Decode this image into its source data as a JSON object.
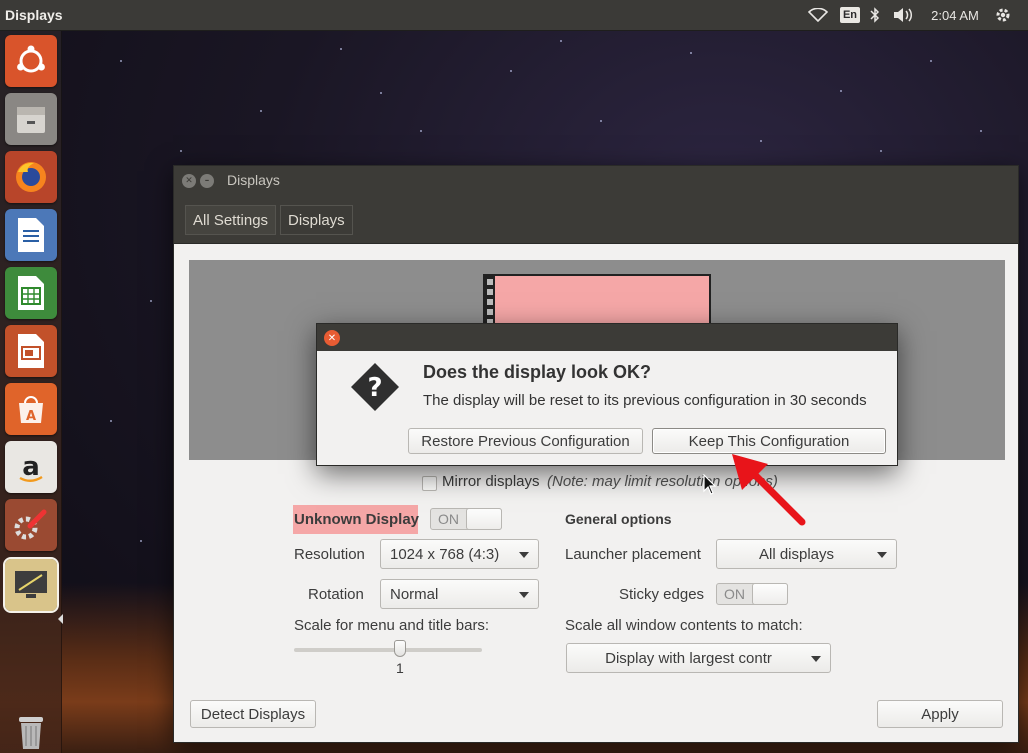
{
  "top_panel": {
    "app_title": "Displays",
    "keyboard_layout": "En",
    "clock": "2:04 AM",
    "icons": [
      "wifi-icon",
      "bluetooth-icon",
      "volume-icon",
      "gear-icon"
    ]
  },
  "launcher": {
    "items": [
      "ubuntu-dash-icon",
      "files-icon",
      "firefox-icon",
      "writer-icon",
      "calc-icon",
      "impress-icon",
      "software-center-icon",
      "amazon-icon",
      "system-settings-icon",
      "displays-icon",
      "trash-icon"
    ]
  },
  "window": {
    "title": "Displays",
    "breadcrumbs": [
      "All Settings",
      "Displays"
    ],
    "mirror_label": "Mirror displays",
    "mirror_note": "(Note: may limit resolution options)",
    "display_name": "Unknown Display",
    "display_switch": "ON",
    "resolution_label": "Resolution",
    "resolution_value": "1024 x 768 (4:3)",
    "rotation_label": "Rotation",
    "rotation_value": "Normal",
    "scale_label": "Scale for menu and title bars:",
    "scale_value": "1",
    "general_heading": "General options",
    "launcher_label": "Launcher placement",
    "launcher_value": "All displays",
    "sticky_label": "Sticky edges",
    "sticky_switch": "ON",
    "scale_all_label": "Scale all window contents to match:",
    "scale_all_value": "Display with largest contr",
    "detect_button": "Detect Displays",
    "apply_button": "Apply"
  },
  "dialog": {
    "heading": "Does the display look OK?",
    "message": "The display will be reset to its previous configuration in 30 seconds",
    "restore_button": "Restore Previous Configuration",
    "keep_button": "Keep This Configuration"
  },
  "colors": {
    "panel": "#3b3a37",
    "accent_close": "#e85c33",
    "display_highlight": "#f5a7a7",
    "annotation_arrow": "#e8141a"
  }
}
